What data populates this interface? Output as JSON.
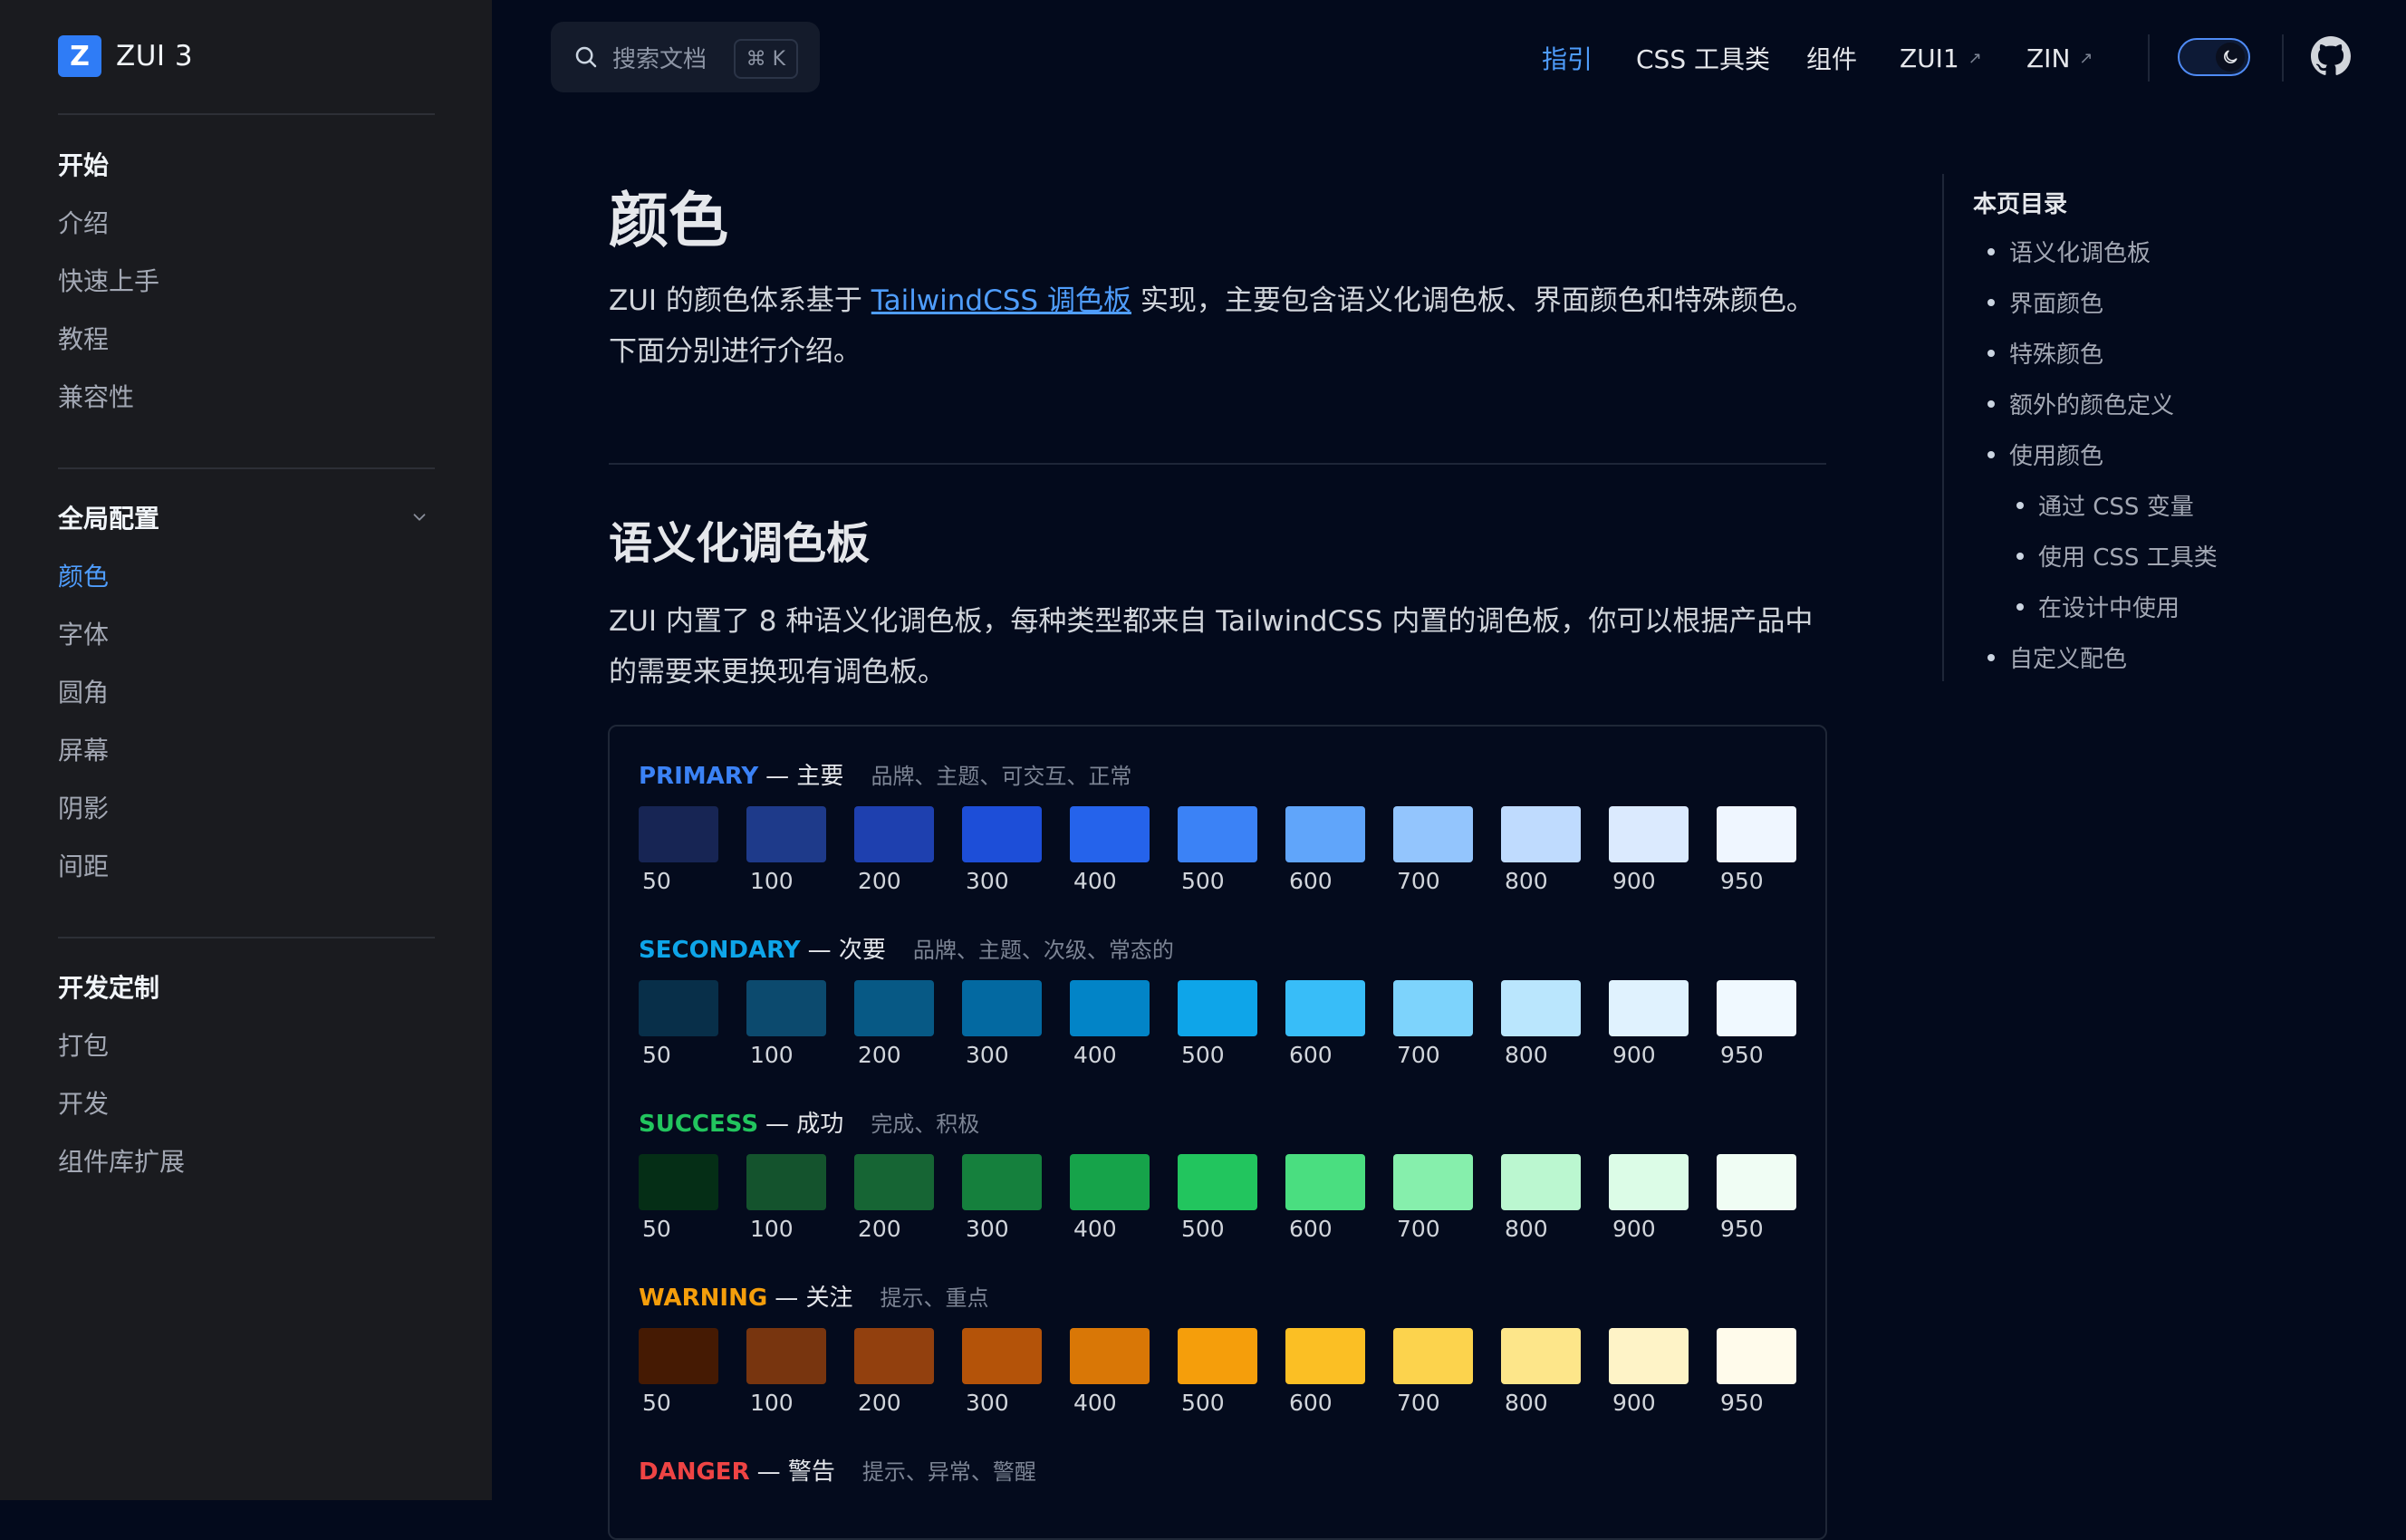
{
  "brand": {
    "logo_letter": "Z",
    "name": "ZUI 3",
    "accent": "#2f7cf6"
  },
  "sidebar": {
    "groups": [
      {
        "title": "开始",
        "items": [
          "介绍",
          "快速上手",
          "教程",
          "兼容性"
        ]
      },
      {
        "title": "全局配置",
        "items": [
          "颜色",
          "字体",
          "圆角",
          "屏幕",
          "阴影",
          "间距"
        ]
      },
      {
        "title": "开发定制",
        "items": [
          "打包",
          "开发",
          "组件库扩展"
        ]
      }
    ],
    "active_item": "颜色"
  },
  "search": {
    "placeholder": "搜索文档",
    "shortcut": "⌘ K"
  },
  "nav": {
    "guide": "指引",
    "css_utils": "CSS 工具类",
    "components": "组件",
    "zui1": "ZUI1",
    "zin": "ZIN",
    "external_arrow": "↗"
  },
  "page": {
    "title": "颜色",
    "intro_before_link": "ZUI 的颜色体系基于 ",
    "intro_link": "TailwindCSS 调色板",
    "intro_after_link": " 实现，主要包含语义化调色板、界面颜色和特殊颜色。下面分别进行介绍。",
    "section_title": "语义化调色板",
    "section_text": "ZUI 内置了 8 种语义化调色板，每种类型都来自 TailwindCSS 内置的调色板，你可以根据产品中的需要来更换现有调色板。"
  },
  "palette_labels": [
    "50",
    "100",
    "200",
    "300",
    "400",
    "500",
    "600",
    "700",
    "800",
    "900",
    "950"
  ],
  "palettes": [
    {
      "name": "PRIMARY",
      "zh": "— 主要",
      "desc": "品牌、主题、可交互、正常",
      "name_color": "#3b82f6",
      "colors": [
        "#172554",
        "#1e3a8a",
        "#1e40af",
        "#1d4ed8",
        "#2563eb",
        "#3b82f6",
        "#60a5fa",
        "#93c5fd",
        "#bfdbfe",
        "#dbeafe",
        "#eff6ff"
      ]
    },
    {
      "name": "SECONDARY",
      "zh": "— 次要",
      "desc": "品牌、主题、次级、常态的",
      "name_color": "#0ea5e9",
      "colors": [
        "#082f49",
        "#0c4a6e",
        "#075985",
        "#0369a1",
        "#0284c7",
        "#0ea5e9",
        "#38bdf8",
        "#7dd3fc",
        "#bae6fd",
        "#e0f2fe",
        "#f0f9ff"
      ]
    },
    {
      "name": "SUCCESS",
      "zh": "— 成功",
      "desc": "完成、积极",
      "name_color": "#22c55e",
      "colors": [
        "#052e16",
        "#14532d",
        "#166534",
        "#15803d",
        "#16a34a",
        "#22c55e",
        "#4ade80",
        "#86efac",
        "#bbf7d0",
        "#dcfce7",
        "#f0fdf4"
      ]
    },
    {
      "name": "WARNING",
      "zh": "— 关注",
      "desc": "提示、重点",
      "name_color": "#f59e0b",
      "colors": [
        "#451a03",
        "#78350f",
        "#92400e",
        "#b45309",
        "#d97706",
        "#f59e0b",
        "#fbbf24",
        "#fcd34d",
        "#fde68a",
        "#fef3c7",
        "#fffbeb"
      ]
    },
    {
      "name": "DANGER",
      "zh": "— 警告",
      "desc": "提示、异常、警醒",
      "name_color": "#ef4444",
      "colors": []
    }
  ],
  "toc": {
    "title": "本页目录",
    "items": [
      "语义化调色板",
      "界面颜色",
      "特殊颜色",
      "额外的颜色定义",
      "使用颜色"
    ],
    "sub_items": [
      "通过 CSS 变量",
      "使用 CSS 工具类",
      "在设计中使用"
    ],
    "last_item": "自定义配色"
  },
  "icons": {
    "search": "search-icon",
    "chevron": "chevron-down-icon",
    "moon": "moon-icon",
    "github": "github-icon"
  }
}
